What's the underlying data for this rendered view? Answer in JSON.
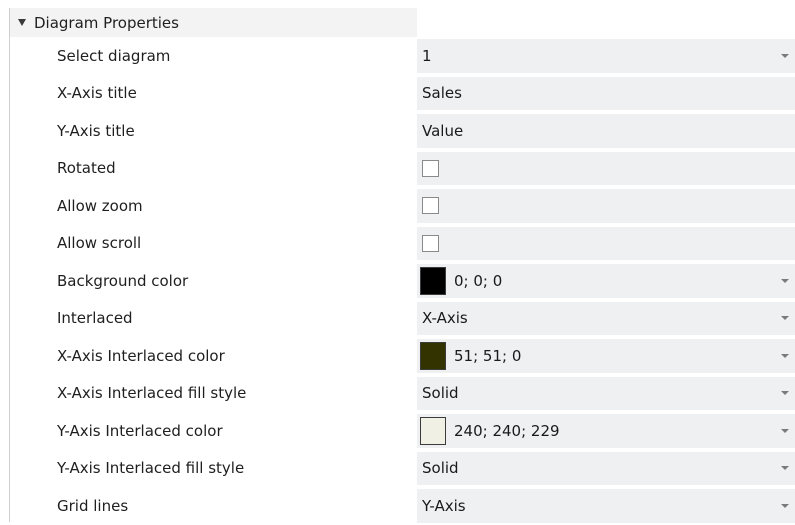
{
  "section": {
    "title": "Diagram Properties",
    "expand_icon": "collapse-triangle-icon"
  },
  "properties": [
    {
      "label": "Select diagram",
      "value": "1",
      "kind": "dropdown"
    },
    {
      "label": "X-Axis title",
      "value": "Sales",
      "kind": "text"
    },
    {
      "label": "Y-Axis title",
      "value": "Value",
      "kind": "text"
    },
    {
      "label": "Rotated",
      "value": "",
      "kind": "checkbox",
      "checked": false
    },
    {
      "label": "Allow zoom",
      "value": "",
      "kind": "checkbox",
      "checked": false
    },
    {
      "label": "Allow scroll",
      "value": "",
      "kind": "checkbox",
      "checked": false
    },
    {
      "label": "Background color",
      "value": "0; 0; 0",
      "kind": "color",
      "color": "#000000"
    },
    {
      "label": "Interlaced",
      "value": "X-Axis",
      "kind": "dropdown"
    },
    {
      "label": "X-Axis Interlaced color",
      "value": "51; 51; 0",
      "kind": "color",
      "color": "#333300"
    },
    {
      "label": "X-Axis Interlaced fill style",
      "value": "Solid",
      "kind": "dropdown"
    },
    {
      "label": "Y-Axis Interlaced color",
      "value": "240; 240; 229",
      "kind": "color",
      "color": "#f0f0e5"
    },
    {
      "label": "Y-Axis Interlaced fill style",
      "value": "Solid",
      "kind": "dropdown"
    },
    {
      "label": "Grid lines",
      "value": "Y-Axis",
      "kind": "dropdown"
    }
  ],
  "colors": {
    "value_background": "#eef0f1",
    "header_background": "#f3f3f3"
  }
}
